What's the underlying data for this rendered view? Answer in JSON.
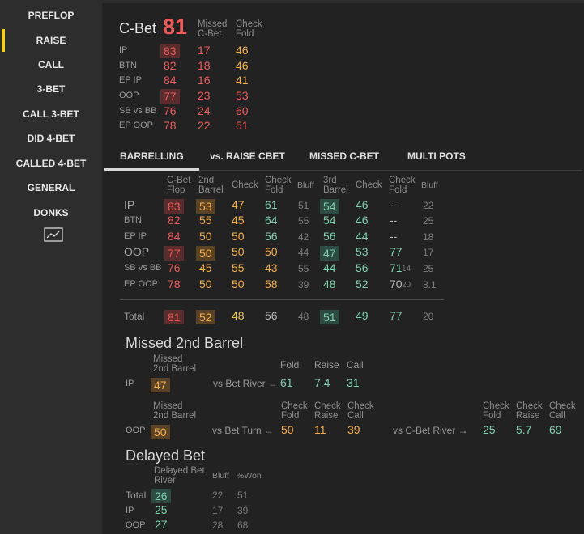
{
  "sidebar": {
    "items": [
      "PREFLOP",
      "RAISE",
      "CALL",
      "3-BET",
      "CALL 3-BET",
      "DID 4-BET",
      "CALLED 4-BET",
      "GENERAL",
      "DONKS"
    ],
    "active": "RAISE",
    "chart_icon": "line-chart-icon",
    "accent_color": "#f2d40f"
  },
  "cbet": {
    "title": "C-Bet",
    "value": "81",
    "col_missed": [
      "Missed",
      "C-Bet"
    ],
    "col_checkfold": [
      "Check",
      "Fold"
    ],
    "rows": [
      {
        "label": "IP",
        "cbet": "83",
        "missed": "17",
        "checkfold": "46"
      },
      {
        "label": "BTN",
        "cbet": "82",
        "missed": "18",
        "checkfold": "46"
      },
      {
        "label": "EP IP",
        "cbet": "84",
        "missed": "16",
        "checkfold": "41"
      },
      {
        "label": "OOP",
        "cbet": "77",
        "missed": "23",
        "checkfold": "53"
      },
      {
        "label": "SB vs BB",
        "cbet": "76",
        "missed": "24",
        "checkfold": "60"
      },
      {
        "label": "EP OOP",
        "cbet": "78",
        "missed": "22",
        "checkfold": "51"
      }
    ]
  },
  "tabs": [
    "BARRELLING",
    "vs. RAISE CBET",
    "MISSED C-BET",
    "MULTI POTS"
  ],
  "active_tab": "BARRELLING",
  "barrel": {
    "headers": {
      "cbet_flop": [
        "C-Bet",
        "Flop"
      ],
      "second_barrel": [
        "2nd",
        "Barrel"
      ],
      "check": "Check",
      "check_fold": [
        "Check",
        "Fold"
      ],
      "bluff": "Bluff",
      "third_barrel": [
        "3rd",
        "Barrel"
      ],
      "check2": "Check",
      "check_fold2": [
        "Check",
        "Fold"
      ],
      "bluff2": "Bluff"
    },
    "rows": [
      {
        "label": "IP",
        "cbet": "83",
        "b2": "53",
        "check": "47",
        "cf": "61",
        "bluff": "51",
        "b3": "54",
        "check2": "46",
        "cf2": "--",
        "bluff2": "22"
      },
      {
        "label": "BTN",
        "cbet": "82",
        "b2": "55",
        "check": "45",
        "cf": "64",
        "bluff": "55",
        "b3": "54",
        "check2": "46",
        "cf2": "--",
        "bluff2": "25"
      },
      {
        "label": "EP IP",
        "cbet": "84",
        "b2": "50",
        "check": "50",
        "cf": "56",
        "bluff": "42",
        "b3": "56",
        "check2": "44",
        "cf2": "--",
        "bluff2": "18"
      },
      {
        "label": "OOP",
        "cbet": "77",
        "b2": "50",
        "check": "50",
        "cf": "50",
        "bluff": "44",
        "b3": "47",
        "check2": "53",
        "cf2": "77",
        "bluff2": "17"
      },
      {
        "label": "SB vs BB",
        "cbet": "76",
        "b2": "45",
        "check": "55",
        "cf": "43",
        "bluff": "55",
        "b3": "44",
        "check2": "56",
        "cf2": "71",
        "cf2_sub": "14",
        "bluff2": "25"
      },
      {
        "label": "EP OOP",
        "cbet": "78",
        "b2": "50",
        "check": "50",
        "cf": "58",
        "bluff": "39",
        "b3": "48",
        "check2": "52",
        "cf2": "70",
        "cf2_sub": "20",
        "bluff2": "8.1"
      }
    ],
    "total": {
      "label": "Total",
      "cbet": "81",
      "b2": "52",
      "check": "48",
      "cf": "56",
      "bluff": "48",
      "b3": "51",
      "check2": "49",
      "cf2": "77",
      "bluff2": "20"
    }
  },
  "missed2": {
    "title": "Missed 2nd Barrel",
    "col_missed": [
      "Missed",
      "2nd Barrel"
    ],
    "ip": {
      "label": "IP",
      "value": "47",
      "arrow_text": "vs Bet River →",
      "headers": [
        "Fold",
        "Raise",
        "Call"
      ],
      "values": [
        "61",
        "7.4",
        "31"
      ]
    },
    "oop": {
      "label": "OOP",
      "value": "50",
      "arrow_text": "vs Bet Turn →",
      "headers": [
        [
          "Check",
          "Fold"
        ],
        [
          "Check",
          "Raise"
        ],
        [
          "Check",
          "Call"
        ]
      ],
      "values": [
        "50",
        "11",
        "39"
      ],
      "arrow_text2": "vs C-Bet River →",
      "headers2": [
        [
          "Check",
          "Fold"
        ],
        [
          "Check",
          "Raise"
        ],
        [
          "Check",
          "Call"
        ]
      ],
      "values2": [
        "25",
        "5.7",
        "69"
      ]
    }
  },
  "delayed": {
    "title": "Delayed Bet",
    "col_db": [
      "Delayed Bet",
      "River"
    ],
    "col_bluff": "Bluff",
    "col_won": "%Won",
    "rows": [
      {
        "label": "Total",
        "db": "26",
        "bluff": "22",
        "won": "51"
      },
      {
        "label": "IP",
        "db": "25",
        "bluff": "17",
        "won": "39"
      },
      {
        "label": "OOP",
        "db": "27",
        "bluff": "28",
        "won": "68"
      }
    ]
  }
}
